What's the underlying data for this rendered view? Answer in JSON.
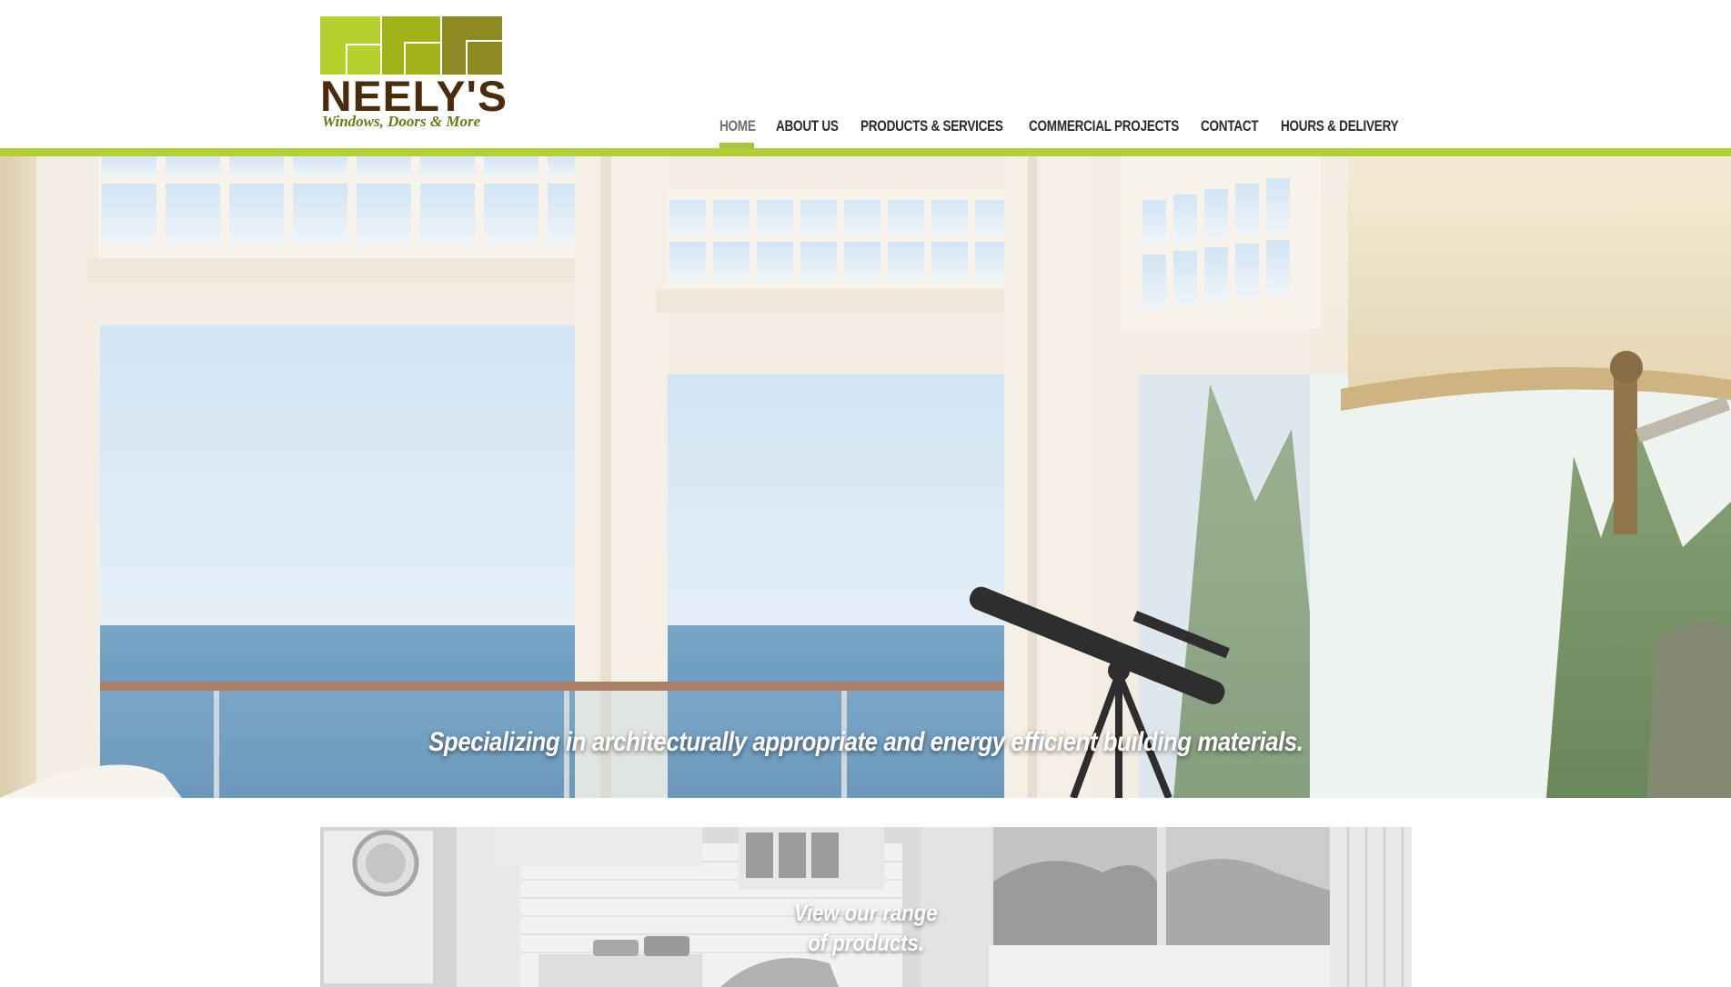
{
  "brand": {
    "name": "NEELY'S",
    "tagline": "Windows, Doors & More",
    "colors": {
      "light_green": "#b7cf2b",
      "mid_green": "#a2b319",
      "olive": "#8e8a22",
      "brown": "#4a2c0c",
      "accent_bar": "#b3cf35"
    }
  },
  "nav": {
    "items": [
      {
        "label": "HOME",
        "active": true
      },
      {
        "label": "ABOUT US",
        "active": false
      },
      {
        "label": "PRODUCTS & SERVICES",
        "active": false
      },
      {
        "label": "COMMERCIAL PROJECTS",
        "active": false
      },
      {
        "label": "CONTACT",
        "active": false
      },
      {
        "label": "HOURS & DELIVERY",
        "active": false
      }
    ]
  },
  "hero": {
    "caption": "Specializing in architecturally appropriate and energy efficient building materials."
  },
  "products_banner": {
    "line1": "View our range",
    "line2": "of products."
  }
}
